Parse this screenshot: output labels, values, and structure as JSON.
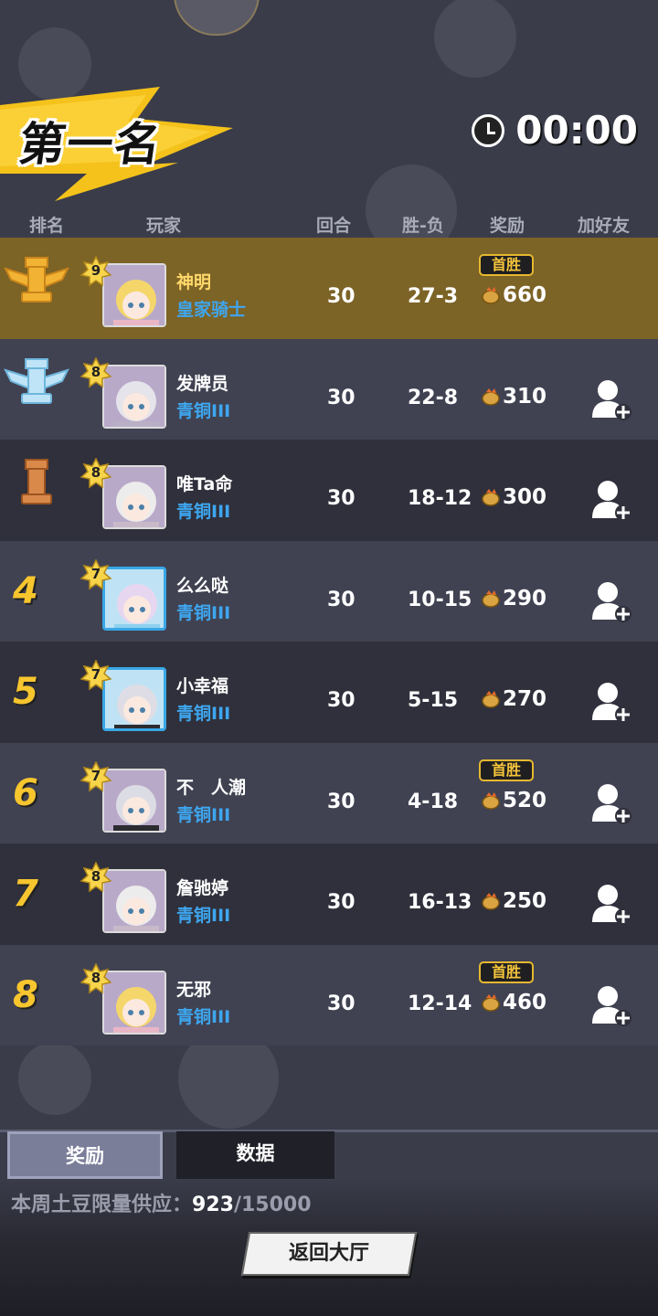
{
  "header": {
    "title": "第一名",
    "timer": "00:00"
  },
  "columns": {
    "rank": "排名",
    "player": "玩家",
    "rounds": "回合",
    "wl": "胜-负",
    "reward": "奖励",
    "add_friend": "加好友"
  },
  "first_win_label": "首胜",
  "rows": [
    {
      "rank_icon": "gold-rook-trophy-icon",
      "level": "9",
      "name": "神明",
      "tier": "皇家骑士",
      "rounds": "30",
      "wl": "27-3",
      "reward": "660",
      "first_win": true,
      "is_me": true
    },
    {
      "rank_icon": "silver-rook-trophy-icon",
      "level": "8",
      "name": "发牌员",
      "tier": "青铜III",
      "rounds": "30",
      "wl": "22-8",
      "reward": "310",
      "first_win": false
    },
    {
      "rank_icon": "bronze-rook-trophy-icon",
      "level": "8",
      "name": "唯Ta命",
      "tier": "青铜III",
      "rounds": "30",
      "wl": "18-12",
      "reward": "300",
      "first_win": false
    },
    {
      "rank": "4",
      "level": "7",
      "name": "么么哒",
      "tier": "青铜III",
      "rounds": "30",
      "wl": "10-15",
      "reward": "290",
      "first_win": false
    },
    {
      "rank": "5",
      "level": "7",
      "name": "小幸福",
      "tier": "青铜III",
      "rounds": "30",
      "wl": "5-15",
      "reward": "270",
      "first_win": false
    },
    {
      "rank": "6",
      "level": "7",
      "name": "不　人潮",
      "tier": "青铜III",
      "rounds": "30",
      "wl": "4-18",
      "reward": "520",
      "first_win": true
    },
    {
      "rank": "7",
      "level": "8",
      "name": "詹驰婷",
      "tier": "青铜III",
      "rounds": "30",
      "wl": "16-13",
      "reward": "250",
      "first_win": false
    },
    {
      "rank": "8",
      "level": "8",
      "name": "无邪",
      "tier": "青铜III",
      "rounds": "30",
      "wl": "12-14",
      "reward": "460",
      "first_win": true
    }
  ],
  "tabs": {
    "reward": "奖励",
    "data": "数据"
  },
  "supply": {
    "label": "本周土豆限量供应：",
    "current": "923",
    "total": "/15000"
  },
  "back_button": "返回大厅",
  "colors": {
    "gold": "#f7c52e",
    "tier_blue": "#3ea6ef",
    "highlight_row": "#7c6326"
  }
}
